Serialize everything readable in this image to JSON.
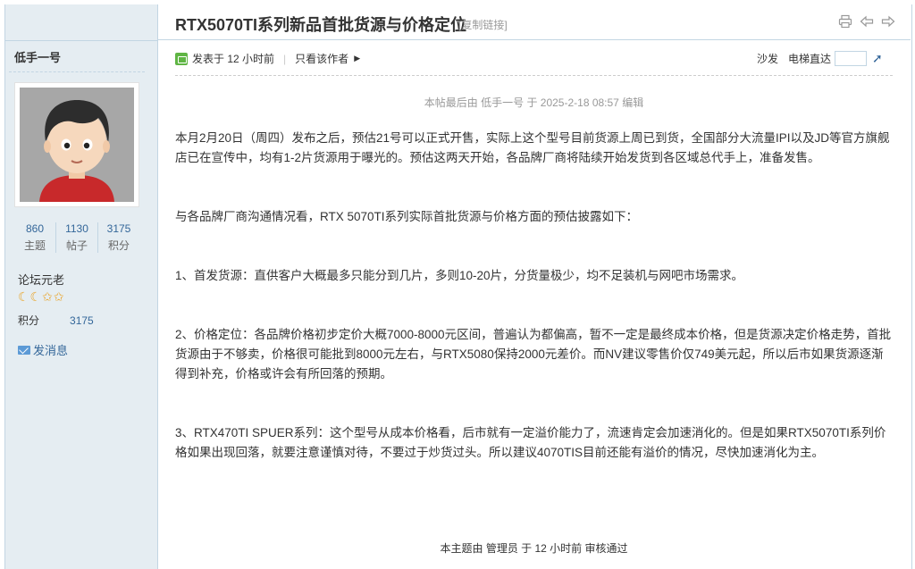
{
  "thread": {
    "title": "RTX5070TI系列新品首批货源与价格定位",
    "copy_link": "[复制链接]"
  },
  "author": {
    "name": "低手一号",
    "stats": [
      {
        "num": "860",
        "label": "主题"
      },
      {
        "num": "1130",
        "label": "帖子"
      },
      {
        "num": "3175",
        "label": "积分"
      }
    ],
    "group": "论坛元老",
    "stars": "☾☾✩✩",
    "score_label": "积分",
    "score_value": "3175",
    "message_label": "发消息"
  },
  "meta": {
    "posted_prefix": "发表于",
    "posted_time": "12 小时前",
    "only_author": "只看该作者",
    "sofa": "沙发",
    "elevator": "电梯直达"
  },
  "post": {
    "edited_note": "本帖最后由 低手一号 于 2025-2-18 08:57 编辑",
    "paragraphs": [
      "本月2月20日（周四）发布之后，预估21号可以正式开售，实际上这个型号目前货源上周已到货，全国部分大流量IPI以及JD等官方旗舰店已在宣传中，均有1-2片货源用于曝光的。预估这两天开始，各品牌厂商将陆续开始发货到各区域总代手上，准备发售。",
      "与各品牌厂商沟通情况看，RTX 5070TI系列实际首批货源与价格方面的预估披露如下：",
      "1、首发货源：直供客户大概最多只能分到几片，多则10-20片，分货量极少，均不足装机与网吧市场需求。",
      "2、价格定位：各品牌价格初步定价大概7000-8000元区间，普遍认为都偏高，暂不一定是最终成本价格，但是货源决定价格走势，首批货源由于不够卖，价格很可能批到8000元左右，与RTX5080保持2000元差价。而NV建议零售价仅749美元起，所以后市如果货源逐渐得到补充，价格或许会有所回落的预期。",
      "3、RTX470TI SPUER系列：这个型号从成本价格看，后市就有一定溢价能力了，流速肯定会加速消化的。但是如果RTX5070TI系列价格如果出现回落，就要注意谨慎对待，不要过于炒货过头。所以建议4070TIS目前还能有溢价的情况，尽快加速消化为主。"
    ],
    "moderation_note": "本主题由 管理员 于 12 小时前 审核通过"
  }
}
